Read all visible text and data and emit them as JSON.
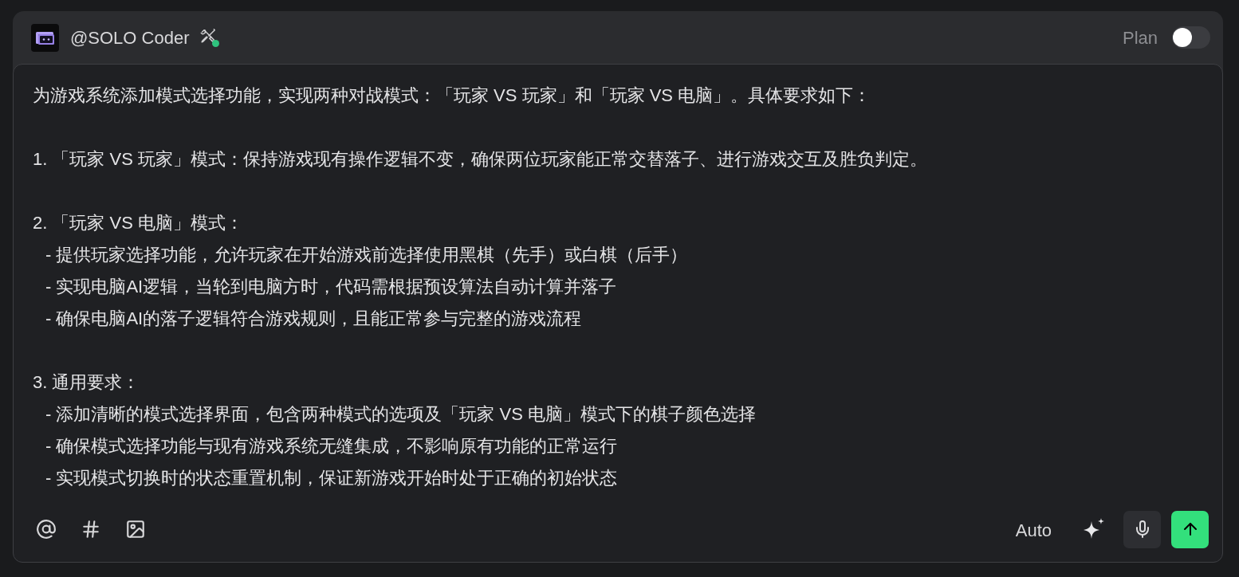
{
  "header": {
    "agent_name": "@SOLO Coder",
    "plan_toggle": {
      "label": "Plan",
      "on": false
    }
  },
  "prompt": {
    "blocks": [
      {
        "lines": [
          {
            "kind": "text",
            "text": "为游戏系统添加模式选择功能，实现两种对战模式：「玩家 VS 玩家」和「玩家 VS 电脑」。具体要求如下："
          }
        ]
      },
      {
        "lines": [
          {
            "kind": "text",
            "text": "1. 「玩家 VS 玩家」模式：保持游戏现有操作逻辑不变，确保两位玩家能正常交替落子、进行游戏交互及胜负判定。"
          }
        ]
      },
      {
        "lines": [
          {
            "kind": "text",
            "text": "2. 「玩家 VS 电脑」模式："
          },
          {
            "kind": "bullet",
            "text": "- 提供玩家选择功能，允许玩家在开始游戏前选择使用黑棋（先手）或白棋（后手）"
          },
          {
            "kind": "bullet",
            "text": "- 实现电脑AI逻辑，当轮到电脑方时，代码需根据预设算法自动计算并落子"
          },
          {
            "kind": "bullet",
            "text": "- 确保电脑AI的落子逻辑符合游戏规则，且能正常参与完整的游戏流程"
          }
        ]
      },
      {
        "lines": [
          {
            "kind": "text",
            "text": "3. 通用要求："
          },
          {
            "kind": "bullet",
            "text": "- 添加清晰的模式选择界面，包含两种模式的选项及「玩家 VS 电脑」模式下的棋子颜色选择"
          },
          {
            "kind": "bullet",
            "text": "- 确保模式选择功能与现有游戏系统无缝集成，不影响原有功能的正常运行"
          },
          {
            "kind": "bullet",
            "text": "- 实现模式切换时的状态重置机制，保证新游戏开始时处于正确的初始状态"
          }
        ]
      }
    ]
  },
  "toolbar": {
    "mode_label": "Auto"
  }
}
